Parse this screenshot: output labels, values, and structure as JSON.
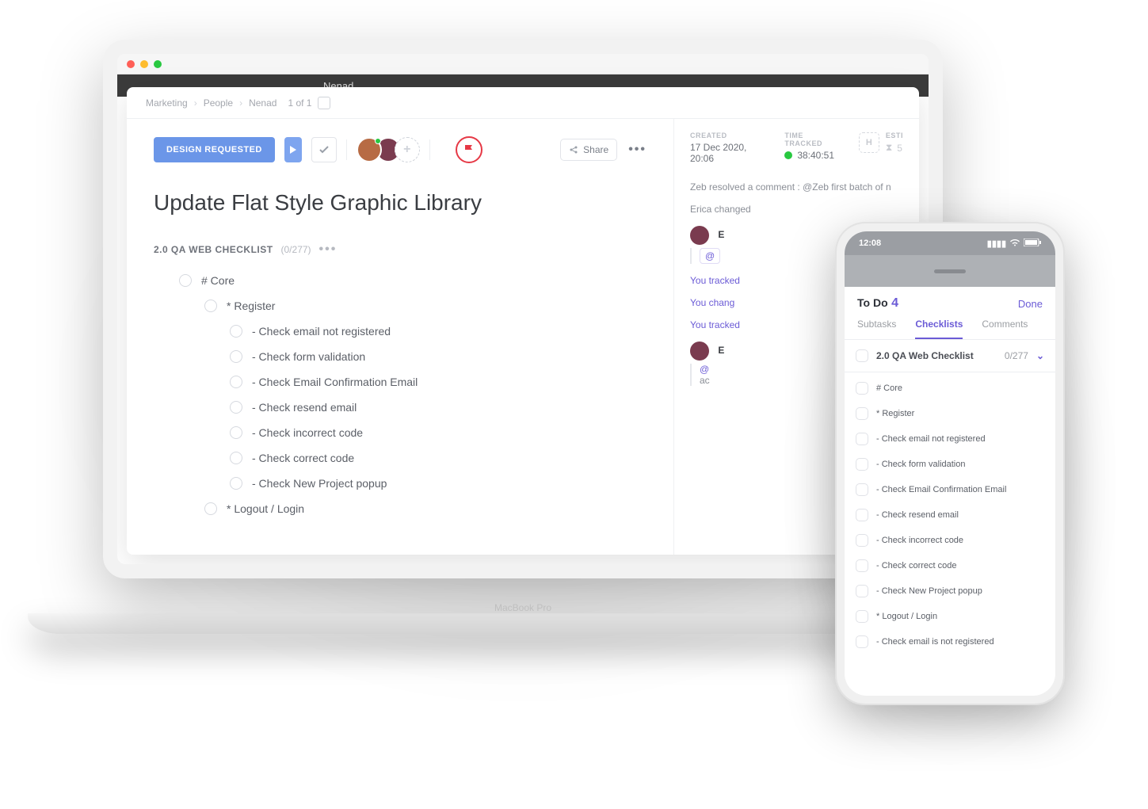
{
  "laptop_label": "MacBook Pro",
  "toolbar_dark_name": "Nenad",
  "breadcrumbs": {
    "c1": "Marketing",
    "c2": "People",
    "c3": "Nenad",
    "pager": "1 of 1"
  },
  "actions": {
    "status_label": "DESIGN REQUESTED",
    "share_label": "Share"
  },
  "task_title": "Update Flat Style Graphic Library",
  "checklist": {
    "name": "2.0 QA WEB CHECKLIST",
    "count": "(0/277)",
    "items": {
      "core": "# Core",
      "register": "* Register",
      "r1": "- Check email not registered",
      "r2": "- Check form validation",
      "r3": "- Check Email Confirmation Email",
      "r4": "- Check resend email",
      "r5": "- Check incorrect code",
      "r6": "- Check correct code",
      "r7": "- Check New Project popup",
      "logout": "* Logout / Login"
    }
  },
  "meta": {
    "created_lbl": "CREATED",
    "created_val": "17 Dec 2020, 20:06",
    "tracked_lbl": "TIME TRACKED",
    "tracked_val": "38:40:51",
    "estimate_lbl": "ESTI",
    "estimate_badge": "H",
    "estimate_val": "5"
  },
  "activity": {
    "l1": "Zeb resolved a comment : @Zeb first batch of n",
    "l2": "Erica changed",
    "box_user": "E",
    "you_tracked": "You tracked",
    "you_changed": "You chang",
    "mention": "@",
    "ac": "ac"
  },
  "phone": {
    "time": "12:08",
    "title": "To Do",
    "title_count": "4",
    "done": "Done",
    "tabs": {
      "t1": "Subtasks",
      "t2": "Checklists",
      "t3": "Comments"
    },
    "section_title": "2.0 QA Web Checklist",
    "section_counter": "0/277",
    "items": {
      "core": "# Core",
      "register": "* Register",
      "r1": "- Check email not registered",
      "r2": "- Check form validation",
      "r3": "- Check Email Confirmation Email",
      "r4": "- Check resend email",
      "r5": "- Check incorrect code",
      "r6": "- Check correct code",
      "r7": "- Check New Project popup",
      "logout": "* Logout / Login",
      "extra": "- Check email is not registered"
    }
  }
}
